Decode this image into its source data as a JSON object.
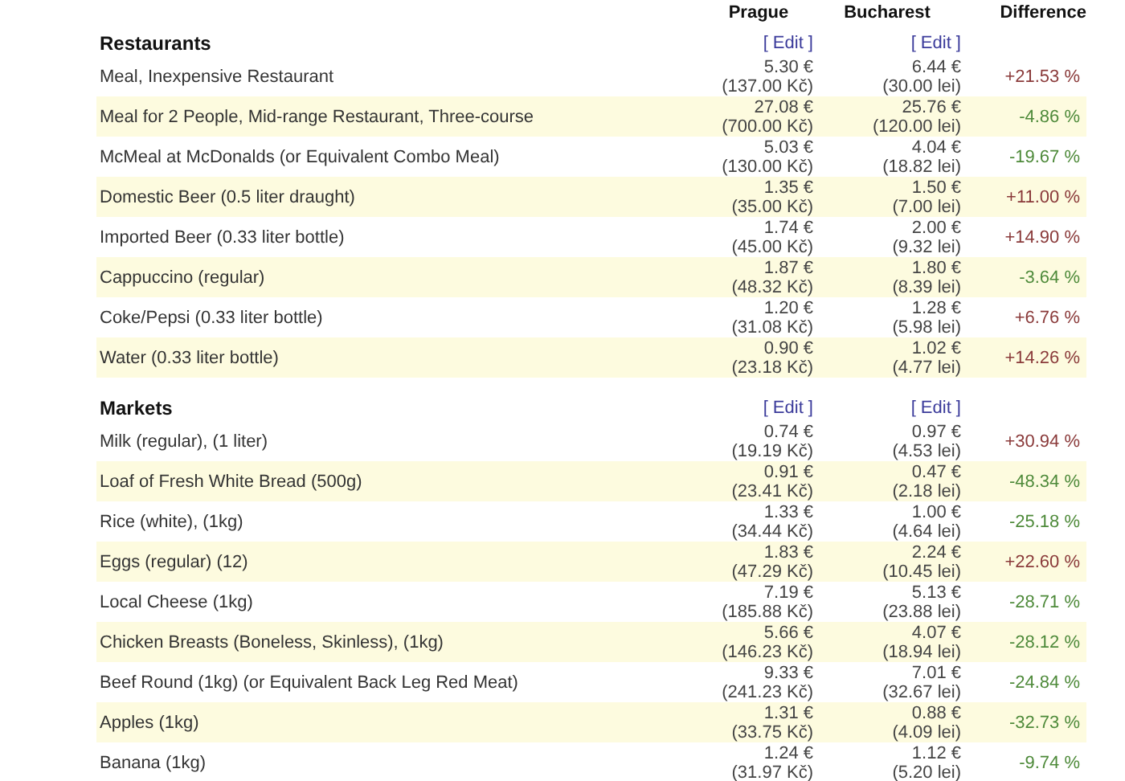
{
  "columns": {
    "city_1": "Prague",
    "city_2": "Bucharest",
    "difference": "Difference"
  },
  "sections": [
    {
      "title": "Restaurants",
      "edit_links": [
        "[ Edit ]",
        "[ Edit ]"
      ],
      "rows": [
        {
          "item": "Meal, Inexpensive Restaurant",
          "city_1": [
            "5.30 €",
            "(137.00 Kč)"
          ],
          "city_2": [
            "6.44 €",
            "(30.00 lei)"
          ],
          "difference": "+21.53 %",
          "increase": true
        },
        {
          "item": "Meal for 2 People, Mid-range Restaurant, Three-course",
          "city_1": [
            "27.08 €",
            "(700.00 Kč)"
          ],
          "city_2": [
            "25.76 €",
            "(120.00 lei)"
          ],
          "difference": "-4.86 %",
          "increase": false
        },
        {
          "item": "McMeal at McDonalds (or Equivalent Combo Meal)",
          "city_1": [
            "5.03 €",
            "(130.00 Kč)"
          ],
          "city_2": [
            "4.04 €",
            "(18.82 lei)"
          ],
          "difference": "-19.67 %",
          "increase": false
        },
        {
          "item": "Domestic Beer (0.5 liter draught)",
          "city_1": [
            "1.35 €",
            "(35.00 Kč)"
          ],
          "city_2": [
            "1.50 €",
            "(7.00 lei)"
          ],
          "difference": "+11.00 %",
          "increase": true
        },
        {
          "item": "Imported Beer (0.33 liter bottle)",
          "city_1": [
            "1.74 €",
            "(45.00 Kč)"
          ],
          "city_2": [
            "2.00 €",
            "(9.32 lei)"
          ],
          "difference": "+14.90 %",
          "increase": true
        },
        {
          "item": "Cappuccino (regular)",
          "city_1": [
            "1.87 €",
            "(48.32 Kč)"
          ],
          "city_2": [
            "1.80 €",
            "(8.39 lei)"
          ],
          "difference": "-3.64 %",
          "increase": false
        },
        {
          "item": "Coke/Pepsi (0.33 liter bottle)",
          "city_1": [
            "1.20 €",
            "(31.08 Kč)"
          ],
          "city_2": [
            "1.28 €",
            "(5.98 lei)"
          ],
          "difference": "+6.76 %",
          "increase": true
        },
        {
          "item": "Water (0.33 liter bottle)",
          "city_1": [
            "0.90 €",
            "(23.18 Kč)"
          ],
          "city_2": [
            "1.02 €",
            "(4.77 lei)"
          ],
          "difference": "+14.26 %",
          "increase": true
        }
      ]
    },
    {
      "title": "Markets",
      "edit_links": [
        "[ Edit ]",
        "[ Edit ]"
      ],
      "rows": [
        {
          "item": "Milk (regular), (1 liter)",
          "city_1": [
            "0.74 €",
            "(19.19 Kč)"
          ],
          "city_2": [
            "0.97 €",
            "(4.53 lei)"
          ],
          "difference": "+30.94 %",
          "increase": true
        },
        {
          "item": "Loaf of Fresh White Bread (500g)",
          "city_1": [
            "0.91 €",
            "(23.41 Kč)"
          ],
          "city_2": [
            "0.47 €",
            "(2.18 lei)"
          ],
          "difference": "-48.34 %",
          "increase": false
        },
        {
          "item": "Rice (white), (1kg)",
          "city_1": [
            "1.33 €",
            "(34.44 Kč)"
          ],
          "city_2": [
            "1.00 €",
            "(4.64 lei)"
          ],
          "difference": "-25.18 %",
          "increase": false
        },
        {
          "item": "Eggs (regular) (12)",
          "city_1": [
            "1.83 €",
            "(47.29 Kč)"
          ],
          "city_2": [
            "2.24 €",
            "(10.45 lei)"
          ],
          "difference": "+22.60 %",
          "increase": true
        },
        {
          "item": "Local Cheese (1kg)",
          "city_1": [
            "7.19 €",
            "(185.88 Kč)"
          ],
          "city_2": [
            "5.13 €",
            "(23.88 lei)"
          ],
          "difference": "-28.71 %",
          "increase": false
        },
        {
          "item": "Chicken Breasts (Boneless, Skinless), (1kg)",
          "city_1": [
            "5.66 €",
            "(146.23 Kč)"
          ],
          "city_2": [
            "4.07 €",
            "(18.94 lei)"
          ],
          "difference": "-28.12 %",
          "increase": false
        },
        {
          "item": "Beef Round (1kg) (or Equivalent Back Leg Red Meat)",
          "city_1": [
            "9.33 €",
            "(241.23 Kč)"
          ],
          "city_2": [
            "7.01 €",
            "(32.67 lei)"
          ],
          "difference": "-24.84 %",
          "increase": false
        },
        {
          "item": "Apples (1kg)",
          "city_1": [
            "1.31 €",
            "(33.75 Kč)"
          ],
          "city_2": [
            "0.88 €",
            "(4.09 lei)"
          ],
          "difference": "-32.73 %",
          "increase": false
        },
        {
          "item": "Banana (1kg)",
          "city_1": [
            "1.24 €",
            "(31.97 Kč)"
          ],
          "city_2": [
            "1.12 €",
            "(5.20 lei)"
          ],
          "difference": "-9.74 %",
          "increase": false
        }
      ]
    }
  ]
}
